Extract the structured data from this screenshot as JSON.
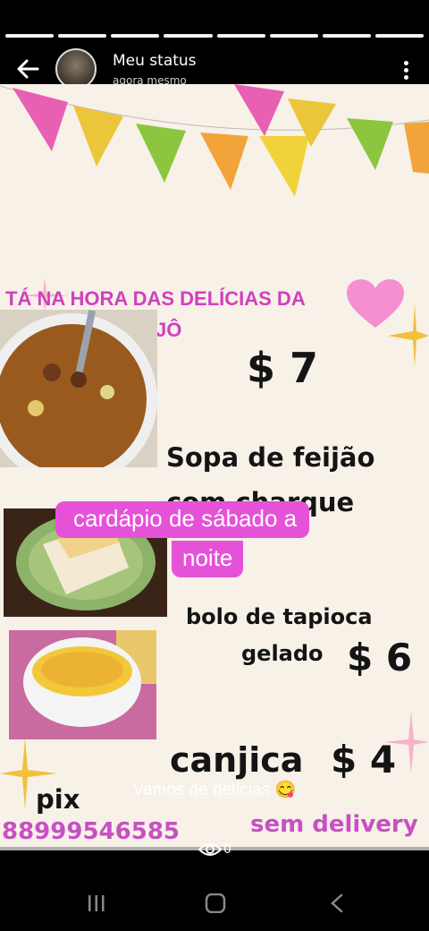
{
  "header": {
    "title": "Meu status",
    "time": "agora mesmo",
    "progress_segments": 8
  },
  "story": {
    "headline_line1": "TÁ  NA HORA DAS DELÍCIAS DA",
    "headline_line2": "JÔ",
    "items": [
      {
        "name_line1": "Sopa de feijão",
        "name_line2": "com charque",
        "price": "$ 7"
      },
      {
        "name_line1": "bolo de tapioca",
        "name_line2": "gelado",
        "price": "$ 6"
      },
      {
        "name_line1": "canjica",
        "price": "$ 4"
      }
    ],
    "overlay_line1": "cardápio de sábado  a",
    "overlay_line2": "noite",
    "pix_label": "pix",
    "phone": "88999546585",
    "delivery_note": "sem delivery"
  },
  "caption": "Vamos de delícias 😋",
  "views_count": "0",
  "colors": {
    "accent_pink": "#e552d8",
    "headline_pink": "#d23fbf",
    "background": "#f7f1e8"
  }
}
